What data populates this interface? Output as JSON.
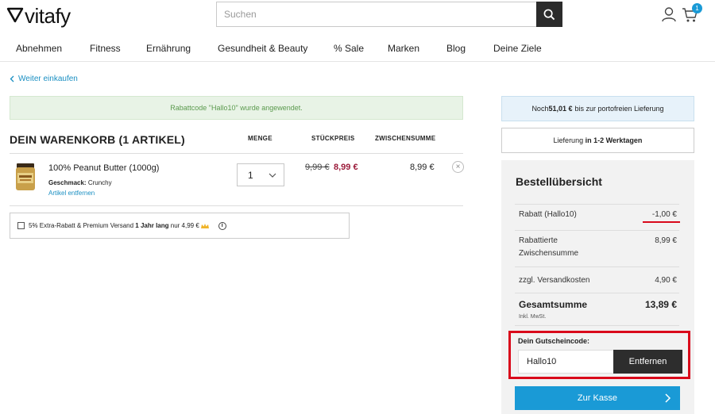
{
  "header": {
    "logo_text": "vitafy",
    "search_placeholder": "Suchen",
    "cart_count": "1"
  },
  "nav": [
    "Abnehmen",
    "Fitness",
    "Ernährung",
    "Gesundheit & Beauty",
    "% Sale",
    "Marken",
    "Blog",
    "Deine Ziele"
  ],
  "back_link": "Weiter einkaufen",
  "notice": "Rabattcode \"Hallo10\" wurde angewendet.",
  "cart": {
    "title": "DEIN WARENKORB (1 ARTIKEL)",
    "columns": [
      "MENGE",
      "STÜCKPREIS",
      "ZWISCHENSUMME"
    ],
    "item": {
      "name": "100% Peanut Butter (1000g)",
      "variant_label": "Geschmack:",
      "variant_value": "Crunchy",
      "remove_label": "Artikel entfernen",
      "quantity": "1",
      "old_price": "9,99 €",
      "new_price": "8,99 €",
      "subtotal": "8,99 €",
      "remove_icon": "×"
    },
    "extra_offer": {
      "pre": "5% Extra-Rabatt & Premium Versand ",
      "bold": "1 Jahr lang",
      "post": " nur 4,99 €"
    }
  },
  "shipping_notice": {
    "pre": "Noch ",
    "amount": "51,01 €",
    "post": " bis zur portofreien Lieferung"
  },
  "delivery_notice": {
    "pre": "Lieferung ",
    "bold": "in 1-2 Werktagen"
  },
  "summary": {
    "title": "Bestellübersicht",
    "rows": [
      {
        "label": "Rabatt (Hallo10)",
        "value": "-1,00 €"
      },
      {
        "label": "Rabattierte Zwischensumme",
        "value": "8,99 €"
      },
      {
        "label": "zzgl. Versandkosten",
        "value": "4,90 €"
      }
    ],
    "total_label": "Gesamtsumme",
    "total_value": "13,89 €",
    "tax_note": "Inkl. MwSt.",
    "voucher_label": "Dein Gutscheincode:",
    "voucher_value": "Hallo10",
    "voucher_button": "Entfernen",
    "checkout_button": "Zur Kasse"
  },
  "colors": {
    "accent": "#1a9ad6",
    "price_red": "#9b1b3a",
    "highlight_red": "#d9091b",
    "success_green": "#5b9a4e"
  }
}
